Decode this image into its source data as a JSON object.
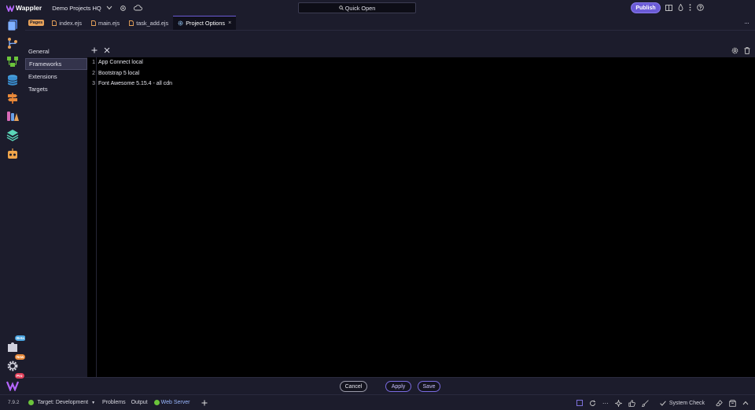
{
  "app": {
    "name": "Wappler",
    "project": "Demo Projects HQ"
  },
  "search": {
    "label": "Quick Open"
  },
  "header": {
    "publish_label": "Publish"
  },
  "rail": {
    "badges": {
      "beta": "Beta",
      "new": "New",
      "pro": "Pro"
    }
  },
  "tabs": {
    "group_label": "Pages",
    "items": [
      {
        "label": "index.ejs"
      },
      {
        "label": "main.ejs"
      },
      {
        "label": "task_add.ejs"
      },
      {
        "label": "Project Options"
      }
    ],
    "close_glyph": "×",
    "more": "···"
  },
  "options_nav": {
    "items": [
      {
        "label": "General"
      },
      {
        "label": "Frameworks"
      },
      {
        "label": "Extensions"
      },
      {
        "label": "Targets"
      }
    ],
    "active_index": 1
  },
  "frameworks": {
    "lines": [
      {
        "num": "1",
        "text": "App Connect local"
      },
      {
        "num": "2",
        "text": "Bootstrap 5 local"
      },
      {
        "num": "3",
        "text": "Font Awesome 5.15.4 - all cdn"
      }
    ]
  },
  "footer": {
    "cancel": "Cancel",
    "apply": "Apply",
    "save": "Save"
  },
  "status": {
    "version": "7.9.2",
    "target": "Target: Development",
    "problems": "Problems",
    "output": "Output",
    "web_server": "Web Server",
    "system_check": "System Check",
    "more": "···"
  },
  "colors": {
    "accent": "#6b5bd6",
    "server_ok": "#6bc43b",
    "panel": "#1c1c2c"
  }
}
